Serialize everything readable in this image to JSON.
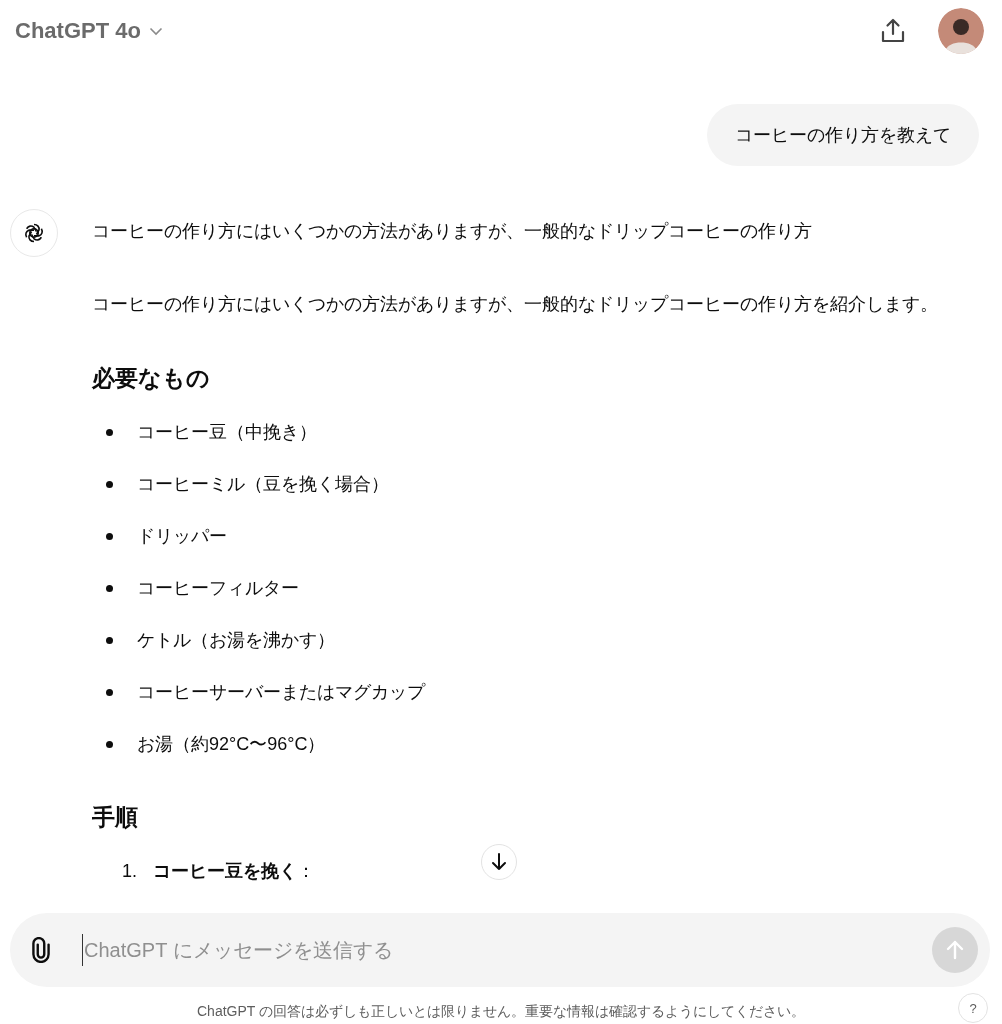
{
  "header": {
    "model": "ChatGPT 4o"
  },
  "messages": [
    {
      "kind": "user",
      "text": "コーヒーの作り方を教えて"
    },
    {
      "kind": "assistant",
      "blocks": [
        {
          "kind": "paragraph",
          "text": "コーヒーの作り方にはいくつかの方法がありますが、一般的なドリップコーヒーの作り方"
        },
        {
          "kind": "paragraph",
          "text": "コーヒーの作り方にはいくつかの方法がありますが、一般的なドリップコーヒーの作り方を紹介します。"
        },
        {
          "kind": "heading",
          "text": "必要なもの"
        },
        {
          "kind": "bullets",
          "items": [
            "コーヒー豆（中挽き）",
            "コーヒーミル（豆を挽く場合）",
            "ドリッパー",
            "コーヒーフィルター",
            "ケトル（お湯を沸かす）",
            "コーヒーサーバーまたはマグカップ",
            "お湯（約92°C〜96°C）"
          ]
        },
        {
          "kind": "heading",
          "text": "手順"
        },
        {
          "kind": "numbered",
          "items": [
            {
              "number": "1.",
              "text": "**コーヒー豆を挽く**："
            }
          ]
        }
      ]
    }
  ],
  "composer": {
    "placeholder": "ChatGPT にメッセージを送信する",
    "send_disabled": true
  },
  "footer": {
    "disclaimer": "ChatGPT の回答は必ずしも正しいとは限りません。重要な情報は確認するようにしてください。",
    "help": "?"
  }
}
